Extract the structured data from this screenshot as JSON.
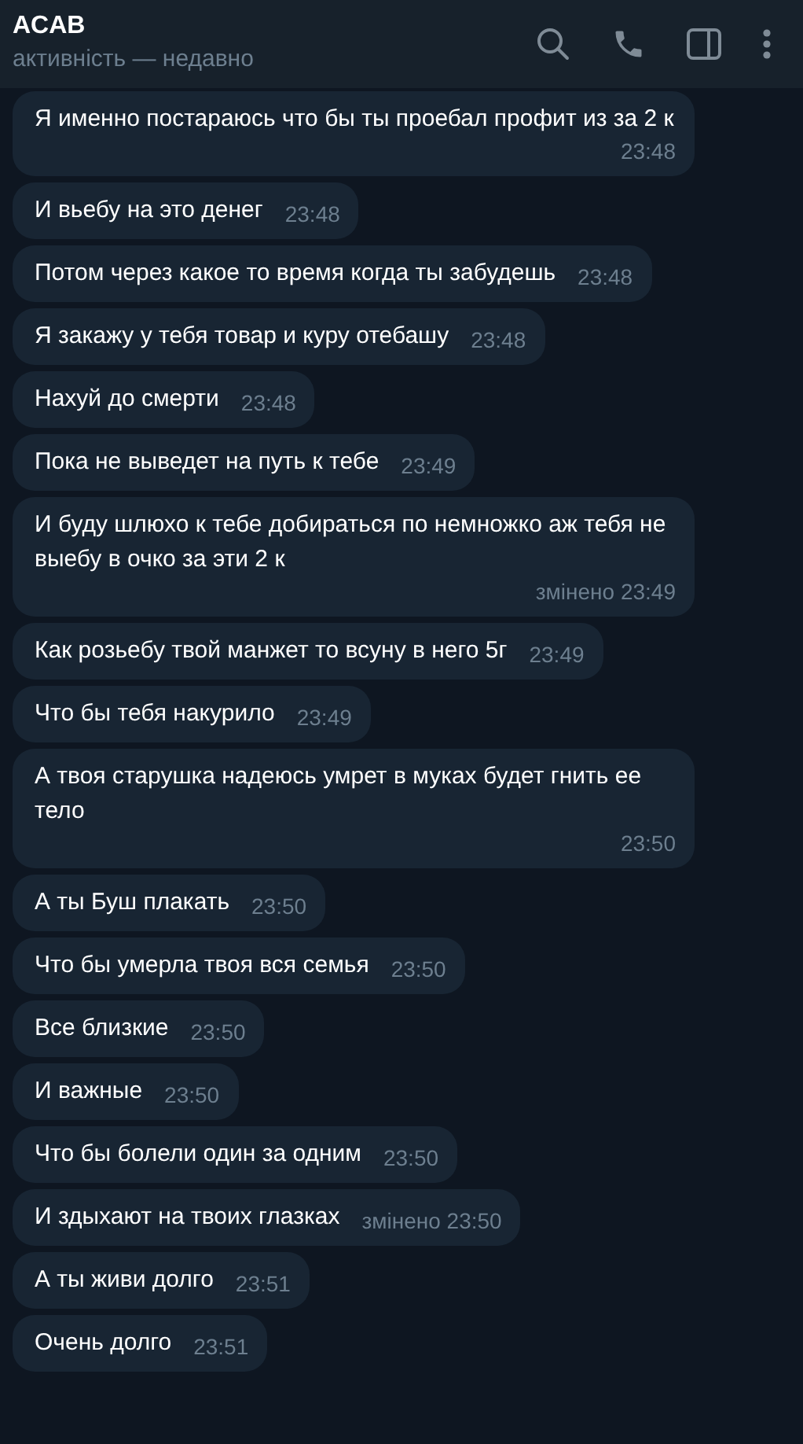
{
  "header": {
    "title": "ACAB",
    "subtitle": "активність — недавно"
  },
  "messages": [
    {
      "text": "Я именно постараюсь что бы ты проебал профит из за 2 к",
      "time": "23:48"
    },
    {
      "text": "И вьебу на это денег",
      "time": "23:48"
    },
    {
      "text": "Потом через какое то время когда ты забудешь",
      "time": "23:48"
    },
    {
      "text": "Я закажу у тебя товар и куру отебашу",
      "time": "23:48"
    },
    {
      "text": "Нахуй до смерти",
      "time": "23:48"
    },
    {
      "text": "Пока не выведет на путь к тебе",
      "time": "23:49"
    },
    {
      "text": "И буду шлюхо к тебе добираться по немножко аж тебя не выебу в очко за эти 2 к",
      "time": "23:49",
      "edited": "змінено"
    },
    {
      "text": "Как розьебу твой манжет то всуну  в него 5г",
      "time": "23:49"
    },
    {
      "text": "Что бы тебя накурило",
      "time": "23:49"
    },
    {
      "text": "А твоя старушка надеюсь умрет в муках будет гнить ее тело",
      "time": "23:50"
    },
    {
      "text": "А ты Буш плакать",
      "time": "23:50"
    },
    {
      "text": "Что бы умерла твоя вся семья",
      "time": "23:50"
    },
    {
      "text": "Все близкие",
      "time": "23:50"
    },
    {
      "text": "И важные",
      "time": "23:50"
    },
    {
      "text": "Что бы болели один за одним",
      "time": "23:50"
    },
    {
      "text": "И здыхают на твоих глазках",
      "time": "23:50",
      "edited": "змінено"
    },
    {
      "text": "А ты живи долго",
      "time": "23:51"
    },
    {
      "text": "Очень долго",
      "time": "23:51"
    }
  ]
}
